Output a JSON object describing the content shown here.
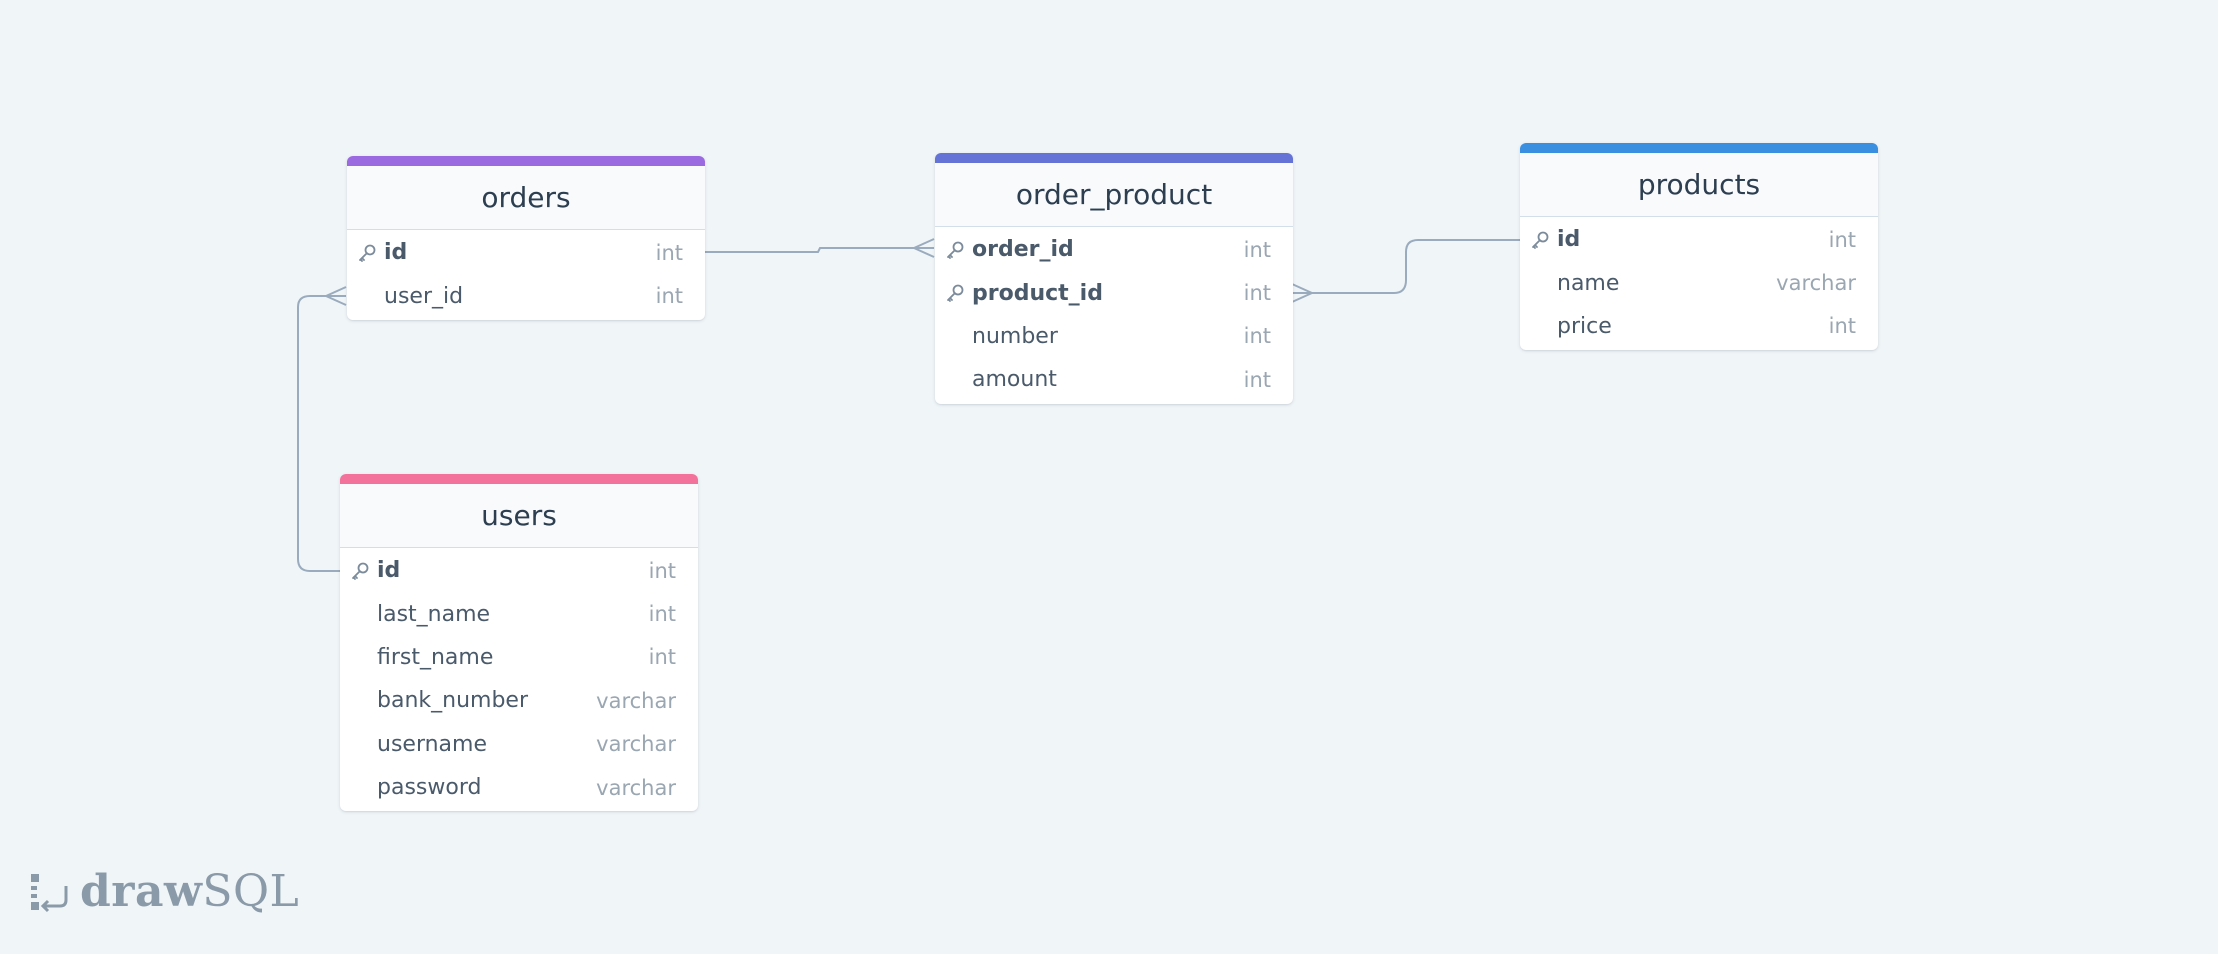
{
  "tables": [
    {
      "id": "orders",
      "title": "orders",
      "color": "#9b6ae0",
      "columns": [
        {
          "name": "id",
          "type": "int",
          "pk": true
        },
        {
          "name": "user_id",
          "type": "int",
          "pk": false
        }
      ]
    },
    {
      "id": "order_product",
      "title": "order_product",
      "color": "#6573d6",
      "columns": [
        {
          "name": "order_id",
          "type": "int",
          "pk": true
        },
        {
          "name": "product_id",
          "type": "int",
          "pk": true
        },
        {
          "name": "number",
          "type": "int",
          "pk": false
        },
        {
          "name": "amount",
          "type": "int",
          "pk": false
        }
      ]
    },
    {
      "id": "products",
      "title": "products",
      "color": "#3b8fe0",
      "columns": [
        {
          "name": "id",
          "type": "int",
          "pk": true
        },
        {
          "name": "name",
          "type": "varchar",
          "pk": false
        },
        {
          "name": "price",
          "type": "int",
          "pk": false
        }
      ]
    },
    {
      "id": "users",
      "title": "users",
      "color": "#f2729b",
      "columns": [
        {
          "name": "id",
          "type": "int",
          "pk": true
        },
        {
          "name": "last_name",
          "type": "int",
          "pk": false
        },
        {
          "name": "first_name",
          "type": "int",
          "pk": false
        },
        {
          "name": "bank_number",
          "type": "varchar",
          "pk": false
        },
        {
          "name": "username",
          "type": "varchar",
          "pk": false
        },
        {
          "name": "password",
          "type": "varchar",
          "pk": false
        }
      ]
    }
  ],
  "relations": [
    {
      "from": "orders.id",
      "to": "order_product.order_id",
      "cardinality": "one-to-many"
    },
    {
      "from": "users.id",
      "to": "orders.user_id",
      "cardinality": "one-to-many"
    },
    {
      "from": "products.id",
      "to": "order_product.product_id",
      "cardinality": "one-to-many"
    }
  ],
  "brand": {
    "bold": "draw",
    "light": "SQL"
  },
  "colors": {
    "background": "#f0f5f8",
    "link": "#9aabbd"
  }
}
